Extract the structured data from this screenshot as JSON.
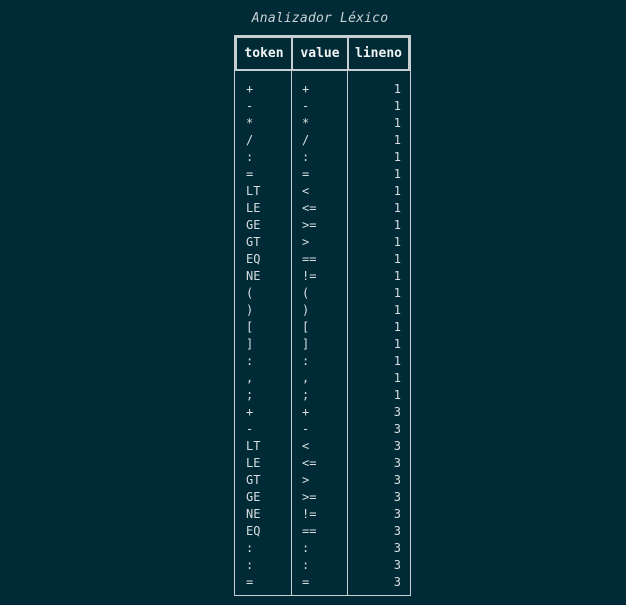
{
  "title": "Analizador Léxico",
  "columns": {
    "token": "token",
    "value": "value",
    "lineno": "lineno"
  },
  "rows": [
    {
      "token": "+",
      "value": "+",
      "lineno": "1"
    },
    {
      "token": "-",
      "value": "-",
      "lineno": "1"
    },
    {
      "token": "*",
      "value": "*",
      "lineno": "1"
    },
    {
      "token": "/",
      "value": "/",
      "lineno": "1"
    },
    {
      "token": ":",
      "value": ":",
      "lineno": "1"
    },
    {
      "token": "=",
      "value": "=",
      "lineno": "1"
    },
    {
      "token": "LT",
      "value": "<",
      "lineno": "1"
    },
    {
      "token": "LE",
      "value": "<=",
      "lineno": "1"
    },
    {
      "token": "GE",
      "value": ">=",
      "lineno": "1"
    },
    {
      "token": "GT",
      "value": ">",
      "lineno": "1"
    },
    {
      "token": "EQ",
      "value": "==",
      "lineno": "1"
    },
    {
      "token": "NE",
      "value": "!=",
      "lineno": "1"
    },
    {
      "token": "(",
      "value": "(",
      "lineno": "1"
    },
    {
      "token": ")",
      "value": ")",
      "lineno": "1"
    },
    {
      "token": "[",
      "value": "[",
      "lineno": "1"
    },
    {
      "token": "]",
      "value": "]",
      "lineno": "1"
    },
    {
      "token": ":",
      "value": ":",
      "lineno": "1"
    },
    {
      "token": ",",
      "value": ",",
      "lineno": "1"
    },
    {
      "token": ";",
      "value": ";",
      "lineno": "1"
    },
    {
      "token": "+",
      "value": "+",
      "lineno": "3"
    },
    {
      "token": "-",
      "value": "-",
      "lineno": "3"
    },
    {
      "token": "LT",
      "value": "<",
      "lineno": "3"
    },
    {
      "token": "LE",
      "value": "<=",
      "lineno": "3"
    },
    {
      "token": "GT",
      "value": ">",
      "lineno": "3"
    },
    {
      "token": "GE",
      "value": ">=",
      "lineno": "3"
    },
    {
      "token": "NE",
      "value": "!=",
      "lineno": "3"
    },
    {
      "token": "EQ",
      "value": "==",
      "lineno": "3"
    },
    {
      "token": ":",
      "value": ":",
      "lineno": "3"
    },
    {
      "token": ":",
      "value": ":",
      "lineno": "3"
    },
    {
      "token": "=",
      "value": "=",
      "lineno": "3"
    }
  ]
}
